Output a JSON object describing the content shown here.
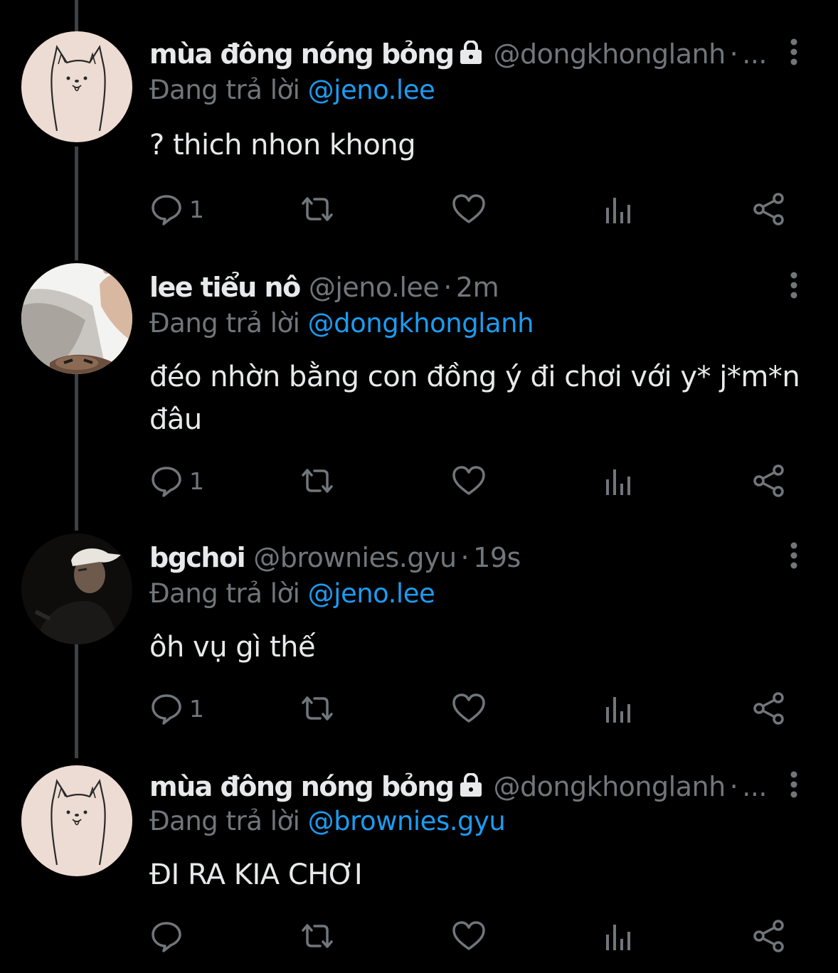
{
  "replying_label": "Đang trả lời",
  "tweets": [
    {
      "name": "mùa đông nóng bỏng",
      "locked": true,
      "handle": "@dongkhonglanh",
      "time": "",
      "ellipsis": "...",
      "reply_to": "@jeno.lee",
      "text": "? thich nhon khong",
      "reply_count": "1",
      "avatar": "dog-drawing-avatar"
    },
    {
      "name": "lee tiểu nô",
      "locked": false,
      "handle": "@jeno.lee",
      "time": "2m",
      "ellipsis": "",
      "reply_to": "@dongkhonglanh",
      "text": "đéo nhờn bằng con đồng ý đi chơi với y* j*m*n đâu",
      "reply_count": "1",
      "avatar": "photo-avatar-peace-sign"
    },
    {
      "name": "bgchoi",
      "locked": false,
      "handle": "@brownies.gyu",
      "time": "19s",
      "ellipsis": "",
      "reply_to": "@jeno.lee",
      "text": "ôh vụ gì thế",
      "reply_count": "1",
      "avatar": "photo-avatar-cap"
    },
    {
      "name": "mùa đông nóng bỏng",
      "locked": true,
      "handle": "@dongkhonglanh",
      "time": "",
      "ellipsis": "...",
      "reply_to": "@brownies.gyu",
      "text": "ĐI RA KIA CHƠI",
      "reply_count": "",
      "avatar": "dog-drawing-avatar"
    }
  ],
  "icons": {
    "reply": "reply-icon",
    "retweet": "retweet-icon",
    "like": "heart-icon",
    "views": "views-icon",
    "share": "share-icon",
    "more": "more-vertical-icon",
    "lock": "lock-icon"
  },
  "colors": {
    "background": "#000000",
    "text": "#e7e9ea",
    "muted": "#71767b",
    "link": "#1d9bf0",
    "thread_line": "#3e4144"
  }
}
